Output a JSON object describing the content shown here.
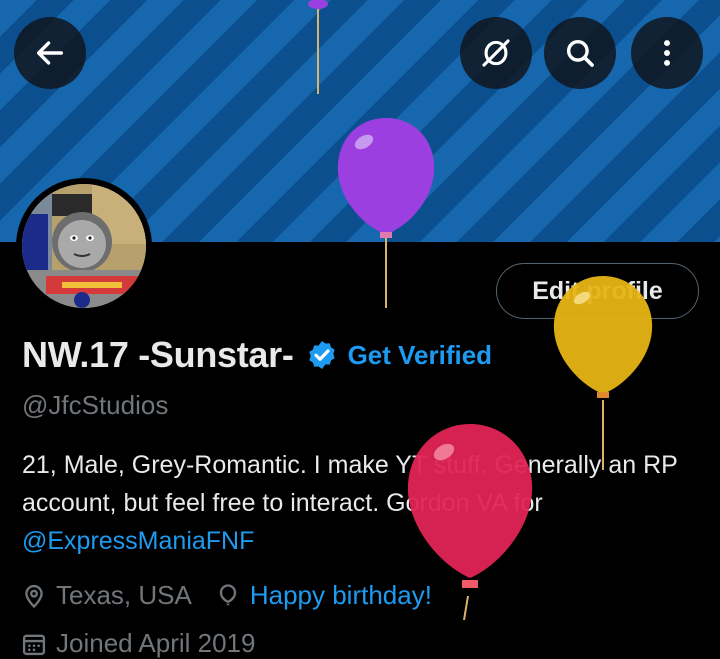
{
  "header": {
    "back_icon": "arrow-left-icon",
    "buttons": [
      "hide-icon",
      "search-icon",
      "more-vertical-icon"
    ]
  },
  "profile": {
    "display_name": "NW.17 -Sunstar-",
    "get_verified": "Get Verified",
    "handle": "@JfcStudios",
    "edit_profile": "Edit profile",
    "bio_text": "21, Male, Grey-Romantic. I make YT stuff.  Generally an RP account, but feel free to interact.  Gordon VA for ",
    "bio_mention": "@ExpressManiaFNF",
    "location": "Texas, USA",
    "birthday": "Happy birthday!",
    "joined": "Joined April 2019"
  },
  "colors": {
    "accent": "#1d9bf0",
    "muted": "#71767b",
    "banner_stripe_light": "#1667ad",
    "banner_stripe_dark": "#0b4f8e",
    "balloon_purple": "#9b3fe0",
    "balloon_yellow": "#e6b414",
    "balloon_red": "#e02454"
  }
}
